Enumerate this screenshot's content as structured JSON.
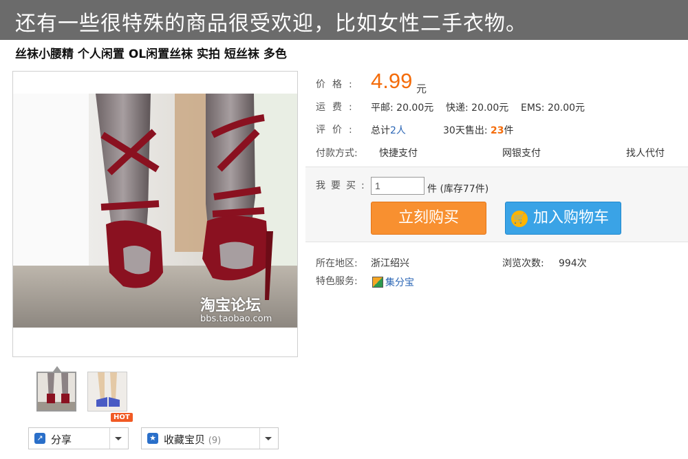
{
  "banner": {
    "text": "还有一些很特殊的商品很受欢迎，比如女性二手衣物。"
  },
  "item": {
    "title": "丝袜小腰精 个人闲置 OL闲置丝袜 实拍 短丝袜 多色"
  },
  "watermark": {
    "logo": "淘宝论坛",
    "url": "bbs.taobao.com"
  },
  "price": {
    "label": "价格:",
    "value": "4.99",
    "unit": "元"
  },
  "shipping": {
    "label": "运费:",
    "surface": "平邮: 20.00元",
    "express": "快递: 20.00元",
    "ems": "EMS: 20.00元"
  },
  "review": {
    "label": "评价:",
    "total_prefix": "总计",
    "total_link": "2人",
    "sold_label": "30天售出:",
    "sold_value": "23",
    "sold_unit": "件"
  },
  "payment": {
    "label": "付款方式:",
    "options": [
      "快捷支付",
      "网银支付",
      "找人代付"
    ]
  },
  "buy": {
    "label": "我要买:",
    "quantity": "1",
    "stock_text": "件 (库存77件)",
    "buy_now": "立刻购买",
    "add_cart": "加入购物车"
  },
  "location": {
    "label": "所在地区:",
    "value": "浙江绍兴",
    "views_label": "浏览次数:",
    "views_value": "994次"
  },
  "service": {
    "label": "特色服务:",
    "value": "集分宝"
  },
  "actions": {
    "share": "分享",
    "hot_badge": "HOT",
    "favorite": "收藏宝贝",
    "favorite_count": "(9)"
  },
  "colors": {
    "price": "#f46c0a",
    "buy_now": "#f89030",
    "add_cart": "#3aa3e6",
    "banner": "#6b6b6b"
  }
}
